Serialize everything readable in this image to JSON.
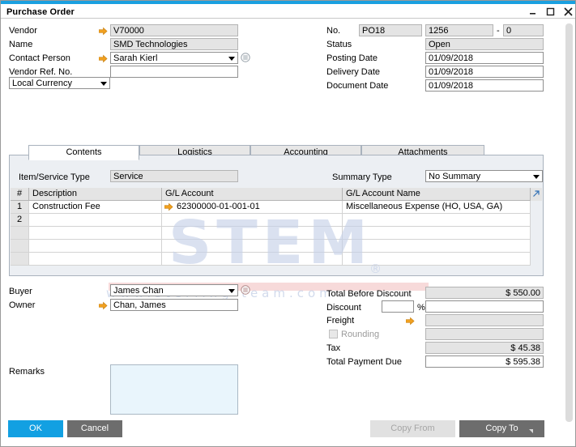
{
  "window": {
    "title": "Purchase Order",
    "controls": {
      "minimize": "minimize-button",
      "maximize": "maximize-button",
      "close": "close-button"
    }
  },
  "header_left": {
    "vendor": {
      "label": "Vendor",
      "value": "V70000"
    },
    "name": {
      "label": "Name",
      "value": "SMD Technologies"
    },
    "contact_person": {
      "label": "Contact Person",
      "value": "Sarah Kierl"
    },
    "vendor_ref_no": {
      "label": "Vendor Ref. No.",
      "value": ""
    },
    "currency": {
      "value": "Local Currency"
    }
  },
  "header_right": {
    "no": {
      "label": "No.",
      "series": "PO18",
      "number": "1256",
      "dash": "-",
      "suffix": "0"
    },
    "status": {
      "label": "Status",
      "value": "Open"
    },
    "posting_date": {
      "label": "Posting Date",
      "value": "01/09/2018"
    },
    "delivery_date": {
      "label": "Delivery Date",
      "value": "01/09/2018"
    },
    "document_date": {
      "label": "Document Date",
      "value": "01/09/2018"
    }
  },
  "tabs": [
    {
      "label": "Contents",
      "active": true
    },
    {
      "label": "Logistics",
      "active": false
    },
    {
      "label": "Accounting",
      "active": false
    },
    {
      "label": "Attachments",
      "active": false
    }
  ],
  "contents": {
    "item_service_type": {
      "label": "Item/Service Type",
      "value": "Service"
    },
    "summary_type": {
      "label": "Summary Type",
      "value": "No Summary"
    },
    "columns": [
      "#",
      "Description",
      "G/L Account",
      "G/L Account Name"
    ],
    "rows": [
      {
        "num": "1",
        "description": "Construction Fee",
        "gl_account": "62300000-01-001-01",
        "gl_account_name": "Miscellaneous Expense (HO, USA, GA)"
      },
      {
        "num": "2",
        "description": "",
        "gl_account": "",
        "gl_account_name": ""
      },
      {
        "num": "",
        "description": "",
        "gl_account": "",
        "gl_account_name": ""
      },
      {
        "num": "",
        "description": "",
        "gl_account": "",
        "gl_account_name": ""
      },
      {
        "num": "",
        "description": "",
        "gl_account": "",
        "gl_account_name": ""
      }
    ]
  },
  "footer_left": {
    "buyer": {
      "label": "Buyer",
      "value": "James Chan"
    },
    "owner": {
      "label": "Owner",
      "value": "Chan, James"
    },
    "remarks": {
      "label": "Remarks",
      "value": ""
    }
  },
  "totals": {
    "total_before_discount": {
      "label": "Total Before Discount",
      "value": "$ 550.00"
    },
    "discount": {
      "label": "Discount",
      "percent": "",
      "percent_sign": "%",
      "value": ""
    },
    "freight": {
      "label": "Freight",
      "value": ""
    },
    "rounding": {
      "label": "Rounding",
      "value": "",
      "checked": false
    },
    "tax": {
      "label": "Tax",
      "value": "$ 45.38"
    },
    "total_payment_due": {
      "label": "Total Payment Due",
      "value": "$ 595.38"
    }
  },
  "buttons": {
    "ok": "OK",
    "cancel": "Cancel",
    "copy_from": "Copy From",
    "copy_to": "Copy To"
  },
  "watermark": {
    "brand": "STEM",
    "registered": "®",
    "url": "www.sterling-team.com"
  },
  "colors": {
    "accent": "#12a0e2",
    "title_strip": "#1aa0e0",
    "arrow": "#f0a020",
    "panel": "#eceff3",
    "readonly_field": "#e4e4e4",
    "remarks_bg": "#e9f5fc",
    "watermark": "#c5d0e8"
  }
}
